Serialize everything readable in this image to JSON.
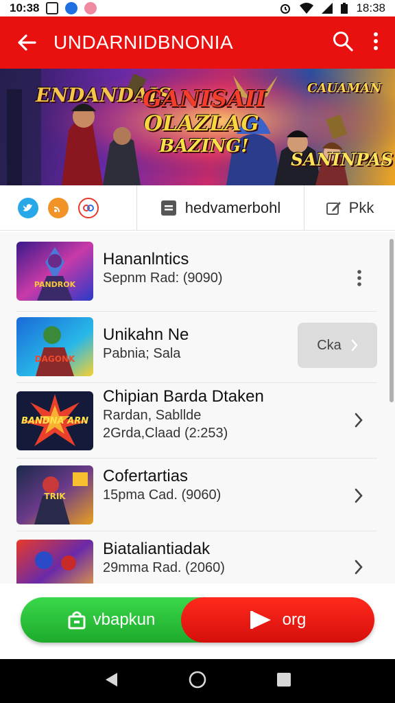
{
  "status_bar": {
    "time_left": "10:38",
    "time_right": "18:38"
  },
  "app_bar": {
    "title": "UNDARNIDBNONIA",
    "back_icon": "arrow-left-icon",
    "search_icon": "search-icon",
    "more_icon": "more-vert-icon"
  },
  "hero": {
    "left_title": "ENDANDAIS",
    "center_line1": "GANISAII",
    "center_line2": "OLAZLAG",
    "center_line3": "BAZING!",
    "right_top": "CAUAMAN",
    "right_bottom": "SANINPAS"
  },
  "share_row": {
    "center_label": "hedvamerbohl",
    "right_label": "Pkk"
  },
  "list": {
    "items": [
      {
        "title": "Hananlntics",
        "sub1": "Sepnm Rad: (9090)",
        "sub2": "",
        "thumb_text": "PANDROK",
        "action": "more"
      },
      {
        "title": "Unikahn Ne",
        "sub1": "Pabnia; Sala",
        "sub2": "",
        "thumb_text": "DAGONK",
        "action": "button",
        "button_label": "Cka"
      },
      {
        "title": "Chipian Barda Dtaken",
        "sub1": "Rardan, Sabllde",
        "sub2": "2Grda,Claad (2:253)",
        "thumb_text": "BANDNA ARN",
        "action": "chevron"
      },
      {
        "title": "Cofertartias",
        "sub1": "15pma Cad. (9060)",
        "sub2": "",
        "thumb_text": "TRIK",
        "action": "chevron"
      },
      {
        "title": "Biataliantiadak",
        "sub1": "29mma Rad. (2060)",
        "sub2": "",
        "thumb_text": "",
        "action": "chevron"
      }
    ]
  },
  "cta": {
    "left_label": "vbapkun",
    "right_label": "org"
  },
  "colors": {
    "app_bar": "#e8110f",
    "cta_green": "#27c23a",
    "cta_red": "#f01a12"
  }
}
